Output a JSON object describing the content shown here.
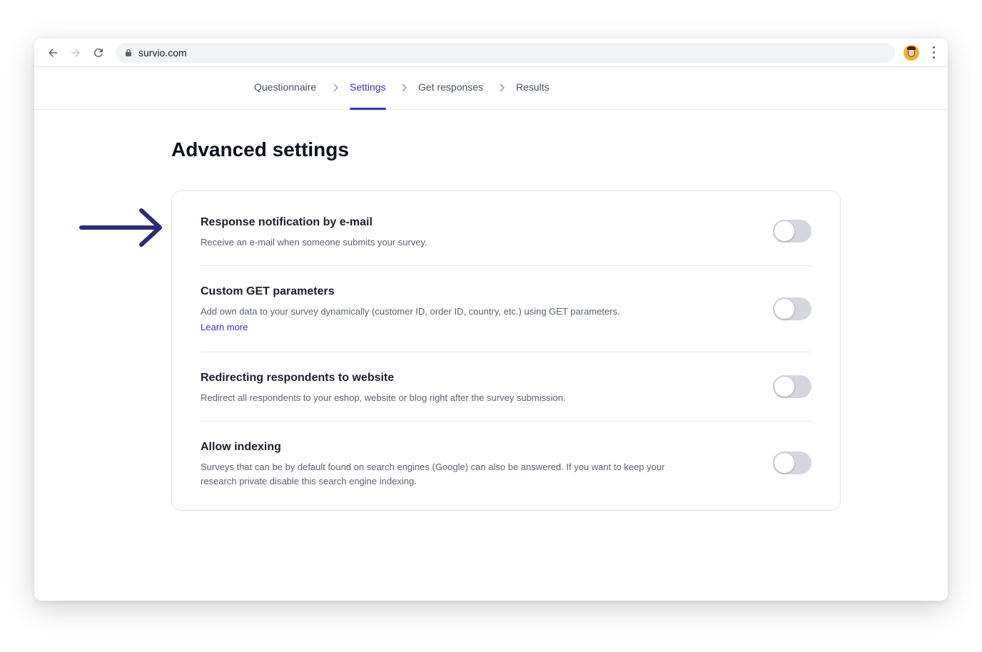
{
  "browser": {
    "url": "survio.com"
  },
  "steps": [
    {
      "label": "Questionnaire"
    },
    {
      "label": "Settings"
    },
    {
      "label": "Get responses"
    },
    {
      "label": "Results"
    }
  ],
  "active_step": "Settings",
  "page": {
    "title": "Advanced settings"
  },
  "settings": [
    {
      "title": "Response notification by e-mail",
      "description": "Receive an e-mail when someone submits your survey.",
      "enabled": false
    },
    {
      "title": "Custom GET parameters",
      "description": "Add own data to your survey dynamically (customer ID, order ID, country, etc.) using GET parameters.",
      "link": "Learn more",
      "enabled": false
    },
    {
      "title": "Redirecting respondents to website",
      "description": "Redirect all respondents to your eshop, website or blog right after the survey submission.",
      "enabled": false
    },
    {
      "title": "Allow indexing",
      "description": "Surveys that can be by default found on search engines (Google) can also be answered. If you want to keep your research private disable this search engine indexing.",
      "enabled": false
    }
  ],
  "colors": {
    "accent": "#3a2fc4",
    "arrow": "#2e2a7a",
    "toggle_off": "#d6d6df"
  },
  "icons": [
    "back-arrow-icon",
    "forward-arrow-icon",
    "reload-icon",
    "lock-icon",
    "avatar",
    "more-vert-icon",
    "chevron-right-icon",
    "arrow-right-icon"
  ]
}
